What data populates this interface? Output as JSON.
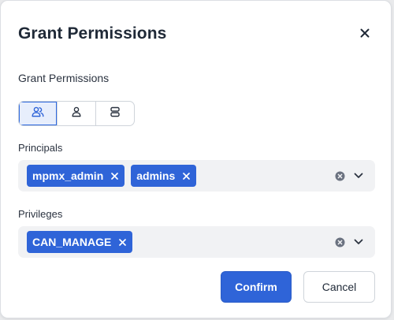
{
  "dialog": {
    "title": "Grant Permissions",
    "close_icon": "close-icon"
  },
  "grant_section": {
    "label": "Grant Permissions",
    "segments": [
      {
        "icon": "users-icon",
        "active": true
      },
      {
        "icon": "user-icon",
        "active": false
      },
      {
        "icon": "database-icon",
        "active": false
      }
    ]
  },
  "principals": {
    "label": "Principals",
    "selected": [
      "mpmx_admin",
      "admins"
    ]
  },
  "privileges": {
    "label": "Privileges",
    "selected": [
      "CAN_MANAGE"
    ]
  },
  "footer": {
    "confirm_label": "Confirm",
    "cancel_label": "Cancel"
  },
  "colors": {
    "accent": "#2f64d8",
    "active_segment_bg": "#e7eefc",
    "field_bg": "#f1f2f4"
  }
}
